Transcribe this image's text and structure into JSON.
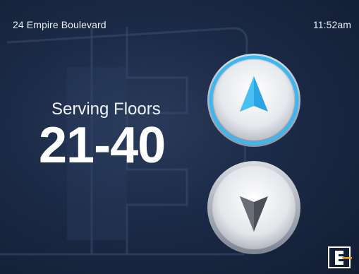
{
  "header": {
    "address": "24 Empire Boulevard",
    "time": "11:52am"
  },
  "status": {
    "serving_label": "Serving Floors",
    "floors_range": "21-40"
  },
  "controls": {
    "up_icon": "up-arrow-icon",
    "down_icon": "down-arrow-icon",
    "selected": "up"
  },
  "brand": {
    "logo_icon": "e-logo-icon",
    "accent": "#f0a21a",
    "up_glow": "#3fb7ee"
  }
}
